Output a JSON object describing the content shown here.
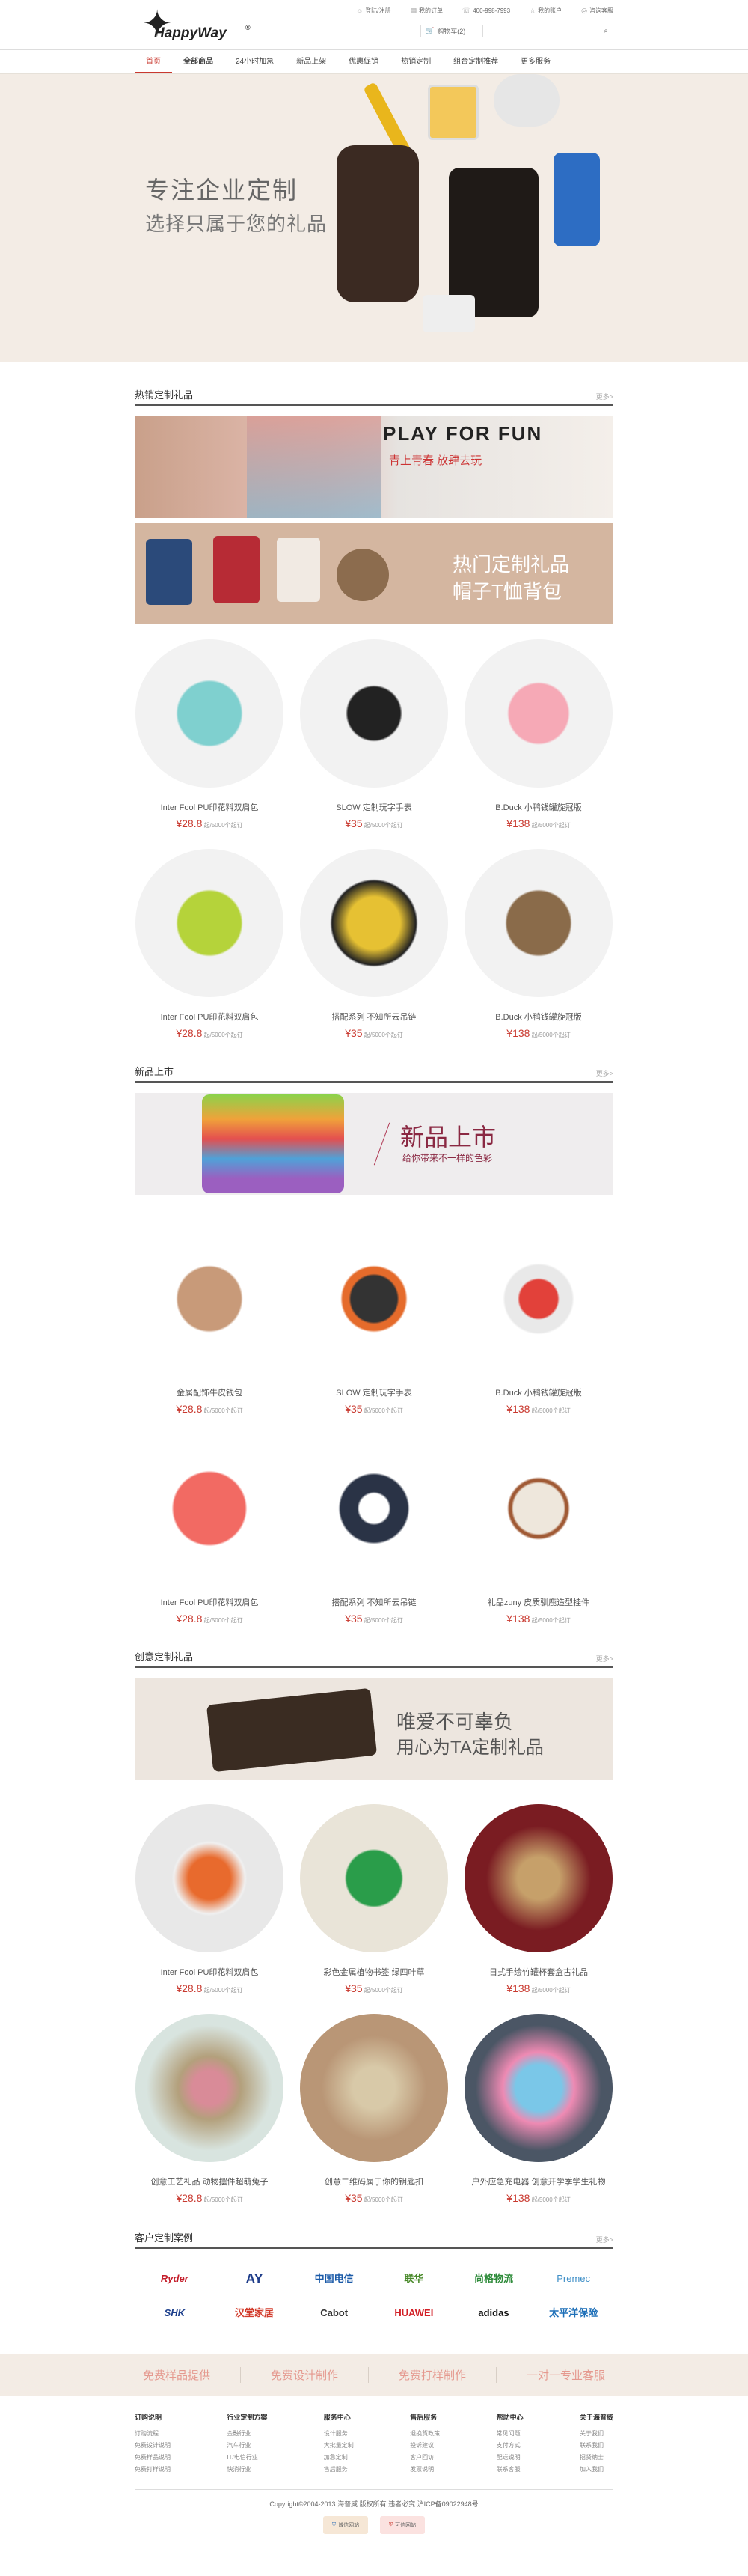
{
  "header": {
    "logo_text": "HappyWay",
    "links": [
      {
        "icon": "user-icon",
        "label": "登陆/注册"
      },
      {
        "icon": "order-icon",
        "label": "我的订单"
      },
      {
        "icon": "phone-icon",
        "label": "400-998-7993"
      },
      {
        "icon": "star-icon",
        "label": "我的账户"
      },
      {
        "icon": "help-icon",
        "label": "咨询客服"
      }
    ],
    "cart_label": "购物车(2)",
    "search_placeholder": ""
  },
  "nav": [
    "首页",
    "全部商品",
    "24小时加急",
    "新品上架",
    "优惠促销",
    "热销定制",
    "组合定制推荐",
    "更多服务"
  ],
  "hero": {
    "title": "专注企业定制",
    "subtitle": "选择只属于您的礼品"
  },
  "sections": [
    {
      "title": "热销定制礼品",
      "more": "更多>",
      "banners": [
        {
          "main": "PLAY FOR FUN",
          "sub": "青上青春   放肆去玩"
        },
        {
          "main": "热门定制礼品",
          "sub": "帽子T恤背包"
        }
      ],
      "items": [
        {
          "name": "Inter Fool PU印花料双肩包",
          "price": "¥28.8",
          "unit": "起/5000个起订"
        },
        {
          "name": "SLOW 定制玩字手表",
          "price": "¥35",
          "unit": "起/5000个起订"
        },
        {
          "name": "B.Duck 小鸭钱罐旋冠版",
          "price": "¥138",
          "unit": "起/5000个起订"
        },
        {
          "name": "Inter Fool PU印花料双肩包",
          "price": "¥28.8",
          "unit": "起/5000个起订"
        },
        {
          "name": "搭配系列 不知所云吊链",
          "price": "¥35",
          "unit": "起/5000个起订"
        },
        {
          "name": "B.Duck 小鸭钱罐旋冠版",
          "price": "¥138",
          "unit": "起/5000个起订"
        }
      ]
    },
    {
      "title": "新品上市",
      "more": "更多>",
      "banners": [
        {
          "main": "新品上市",
          "sub": "给你带来不一样的色彩"
        }
      ],
      "items": [
        {
          "name": "金属配饰牛皮钱包",
          "price": "¥28.8",
          "unit": "起/5000个起订"
        },
        {
          "name": "SLOW 定制玩字手表",
          "price": "¥35",
          "unit": "起/5000个起订"
        },
        {
          "name": "B.Duck 小鸭钱罐旋冠版",
          "price": "¥138",
          "unit": "起/5000个起订"
        },
        {
          "name": "Inter Fool PU印花料双肩包",
          "price": "¥28.8",
          "unit": "起/5000个起订"
        },
        {
          "name": "搭配系列 不知所云吊链",
          "price": "¥35",
          "unit": "起/5000个起订"
        },
        {
          "name": "礼品zuny 皮质驯鹿造型挂件",
          "price": "¥138",
          "unit": "起/5000个起订"
        }
      ]
    },
    {
      "title": "创意定制礼品",
      "more": "更多>",
      "banners": [
        {
          "main": "唯爱不可辜负",
          "sub": "用心为TA定制礼品"
        }
      ],
      "items": [
        {
          "name": "Inter Fool PU印花料双肩包",
          "price": "¥28.8",
          "unit": "起/5000个起订"
        },
        {
          "name": "彩色金属植物书签 绿四叶草",
          "price": "¥35",
          "unit": "起/5000个起订"
        },
        {
          "name": "日式手绘竹罐杯套盒古礼品",
          "price": "¥138",
          "unit": "起/5000个起订"
        },
        {
          "name": "创意工艺礼品 动物摆件超萌兔子",
          "price": "¥28.8",
          "unit": "起/5000个起订"
        },
        {
          "name": "创意二维码属于你的钥匙扣",
          "price": "¥35",
          "unit": "起/5000个起订"
        },
        {
          "name": "户外应急充电器 创意开学季学生礼物",
          "price": "¥138",
          "unit": "起/5000个起订"
        }
      ]
    }
  ],
  "cases": {
    "title": "客户定制案例",
    "more": "更多>",
    "logos": [
      "Ryder",
      "AY",
      "中国电信",
      "联华",
      "尚格物流",
      "Premec",
      "SHK",
      "汉堂家居",
      "Cabot",
      "HUAWEI",
      "adidas",
      "太平洋保险"
    ]
  },
  "services": [
    "免费样品提供",
    "免费设计制作",
    "免费打样制作",
    "一对一专业客服"
  ],
  "footer": {
    "cols": [
      {
        "title": "订购说明",
        "items": [
          "订购流程",
          "免费设计说明",
          "免费样品说明",
          "免费打样说明"
        ]
      },
      {
        "title": "行业定制方案",
        "items": [
          "金融行业",
          "汽车行业",
          "IT/电信行业",
          "快消行业"
        ]
      },
      {
        "title": "服务中心",
        "items": [
          "设计服务",
          "大批量定制",
          "加急定制",
          "售后服务"
        ]
      },
      {
        "title": "售后服务",
        "items": [
          "退换货政策",
          "投诉建议",
          "客户回访",
          "发票说明"
        ]
      },
      {
        "title": "帮助中心",
        "items": [
          "常见问题",
          "支付方式",
          "配送说明",
          "联系客服"
        ]
      },
      {
        "title": "关于海普威",
        "items": [
          "关于我们",
          "联系我们",
          "招贤纳士",
          "加入我们"
        ]
      }
    ],
    "copyright": "Copyright©2004-2013 海普威 版权所有 违者必究 沪ICP备09022948号",
    "badges": [
      "诚信网站",
      "可信网站"
    ]
  }
}
